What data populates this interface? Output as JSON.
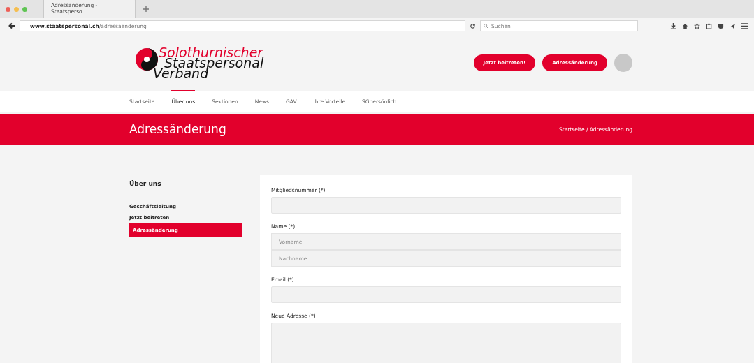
{
  "browser": {
    "tab_title": "Adressänderung - Staatsperso...",
    "url_domain": "www.staatspersonal.ch",
    "url_path": "/adressaenderung",
    "search_placeholder": "Suchen"
  },
  "logo": {
    "line_1": "Solothurnischer",
    "line_2": "Staatspersonal",
    "line_3": "Verband"
  },
  "header_buttons": [
    "Jetzt beitreten!",
    "Adressänderung"
  ],
  "nav": [
    {
      "label": "Startseite",
      "selected": false
    },
    {
      "label": "Über uns",
      "selected": true
    },
    {
      "label": "Sektionen",
      "selected": false
    },
    {
      "label": "News",
      "selected": false
    },
    {
      "label": "GAV",
      "selected": false
    },
    {
      "label": "Ihre Vorteile",
      "selected": false
    },
    {
      "label": "SGpersönlich",
      "selected": false
    }
  ],
  "page_title": "Adressänderung",
  "breadcrumb": "Startseite / Adressänderung",
  "sidebar": {
    "title": "Über uns",
    "items": [
      {
        "label": "Geschäftsleitung",
        "selected": false
      },
      {
        "label": "Jetzt beitreten",
        "selected": false
      },
      {
        "label": "Adressänderung",
        "selected": true
      }
    ]
  },
  "form": {
    "fields": [
      {
        "kind": "text",
        "label": "Mitgliedsnummer (*)"
      },
      {
        "kind": "pair",
        "label": "Name (*)",
        "placeholders": [
          "Vorname",
          "Nachname"
        ]
      },
      {
        "kind": "text",
        "label": "Email (*)"
      },
      {
        "kind": "textarea",
        "label": "Neue Adresse (*)"
      }
    ]
  }
}
